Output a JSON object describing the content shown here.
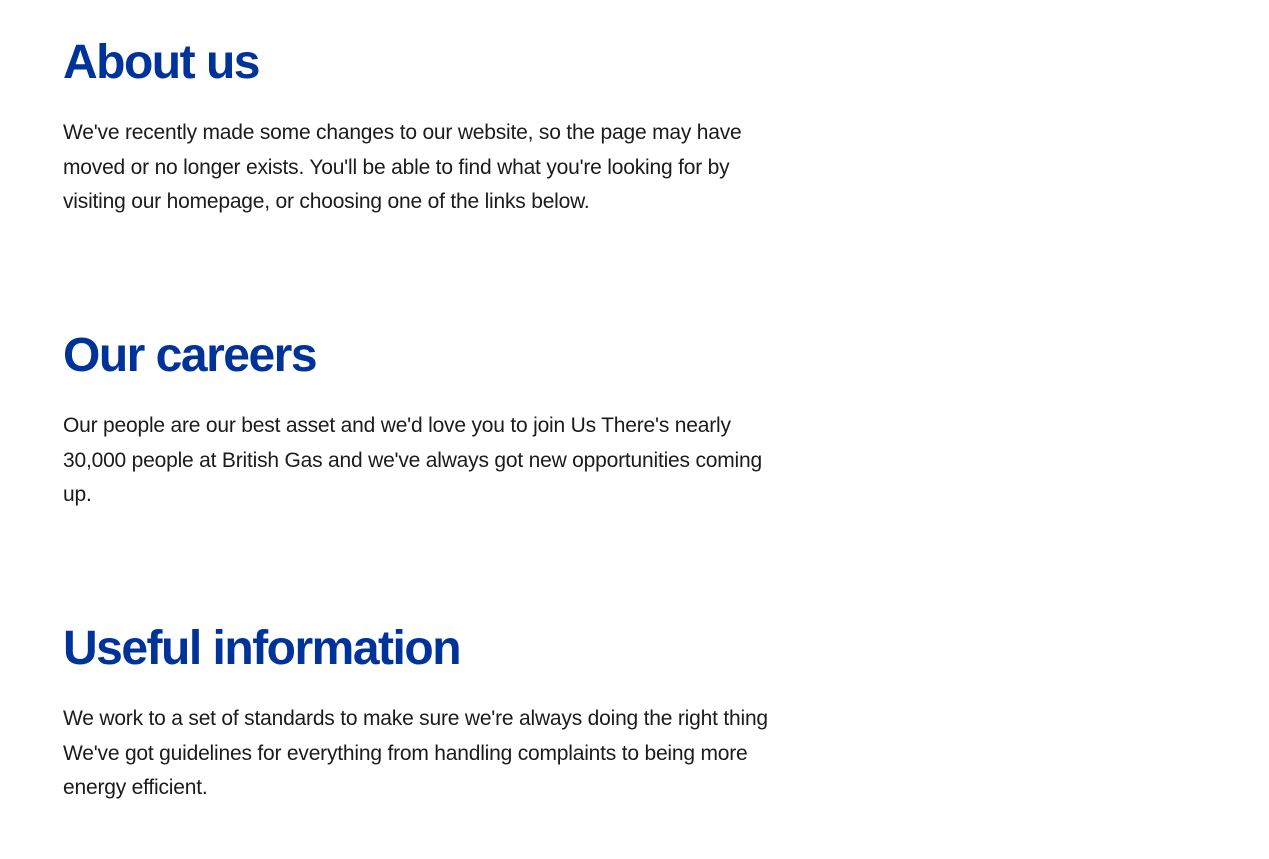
{
  "sections": [
    {
      "heading": "About us",
      "body": "We've recently made some changes to our website, so the page may have moved or no longer exists. You'll be able to find what you're looking for by visiting our homepage, or choosing one of the links below."
    },
    {
      "heading": "Our careers",
      "body": "Our people are our best asset and we'd love you to join Us There's nearly 30,000 people at British Gas and we've always got new opportunities coming up."
    },
    {
      "heading": "Useful information",
      "body": "We work to a set of standards to make sure we're always doing the right thing We've got guidelines for everything from handling complaints to being more energy efficient."
    }
  ],
  "colors": {
    "heading": "#003399",
    "body_text": "#1b1b1b",
    "background": "#ffffff"
  }
}
